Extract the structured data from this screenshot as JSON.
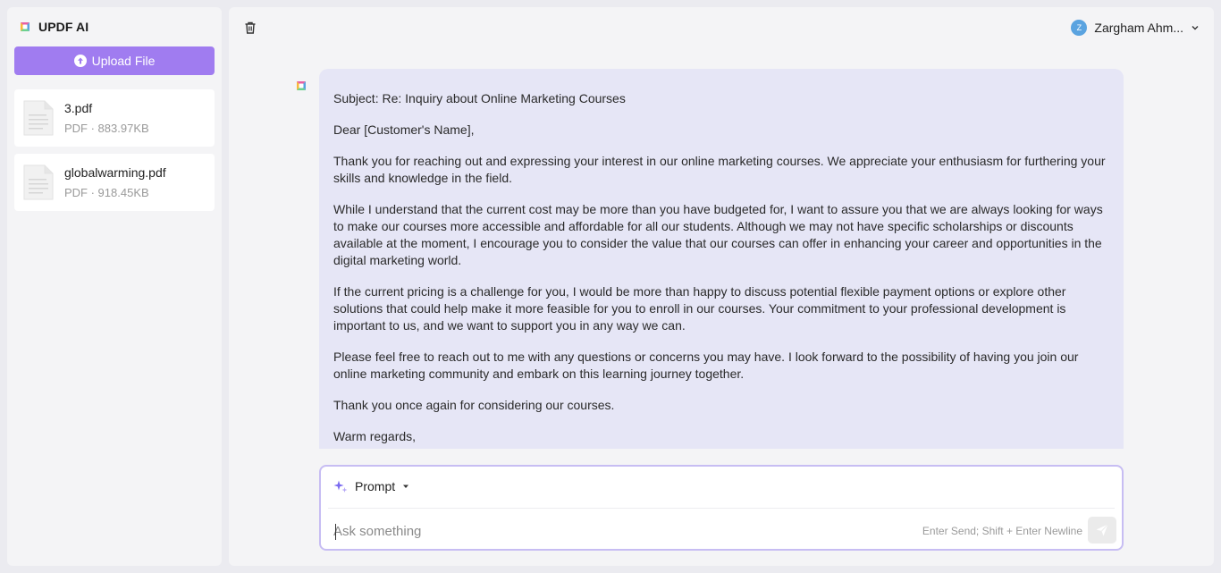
{
  "app": {
    "name": "UPDF AI"
  },
  "sidebar": {
    "upload_label": "Upload File",
    "files": [
      {
        "name": "3.pdf",
        "meta": "PDF · 883.97KB"
      },
      {
        "name": "globalwarming.pdf",
        "meta": "PDF · 918.45KB"
      }
    ]
  },
  "header": {
    "user_initial": "Z",
    "user_name": "Zargham Ahm..."
  },
  "chat": {
    "message": [
      "Subject: Re: Inquiry about Online Marketing Courses",
      "Dear [Customer's Name],",
      "Thank you for reaching out and expressing your interest in our online marketing courses. We appreciate your enthusiasm for furthering your skills and knowledge in the field.",
      "While I understand that the current cost may be more than you have budgeted for, I want to assure you that we are always looking for ways to make our courses more accessible and affordable for all our students. Although we may not have specific scholarships or discounts available at the moment, I encourage you to consider the value that our courses can offer in enhancing your career and opportunities in the digital marketing world.",
      "If the current pricing is a challenge for you, I would be more than happy to discuss potential flexible payment options or explore other solutions that could help make it more feasible for you to enroll in our courses. Your commitment to your professional development is important to us, and we want to support you in any way we can.",
      "Please feel free to reach out to me with any questions or concerns you may have. I look forward to the possibility of having you join our online marketing community and embark on this learning journey together.",
      "Thank you once again for considering our courses.",
      "Warm regards,"
    ]
  },
  "composer": {
    "mode_label": "Prompt",
    "placeholder": "Ask something",
    "value": "",
    "hint": "Enter Send; Shift + Enter Newline"
  },
  "colors": {
    "accent": "#a07cf0",
    "bubble": "#e6e6f6",
    "input_border": "#c7bdf3"
  }
}
